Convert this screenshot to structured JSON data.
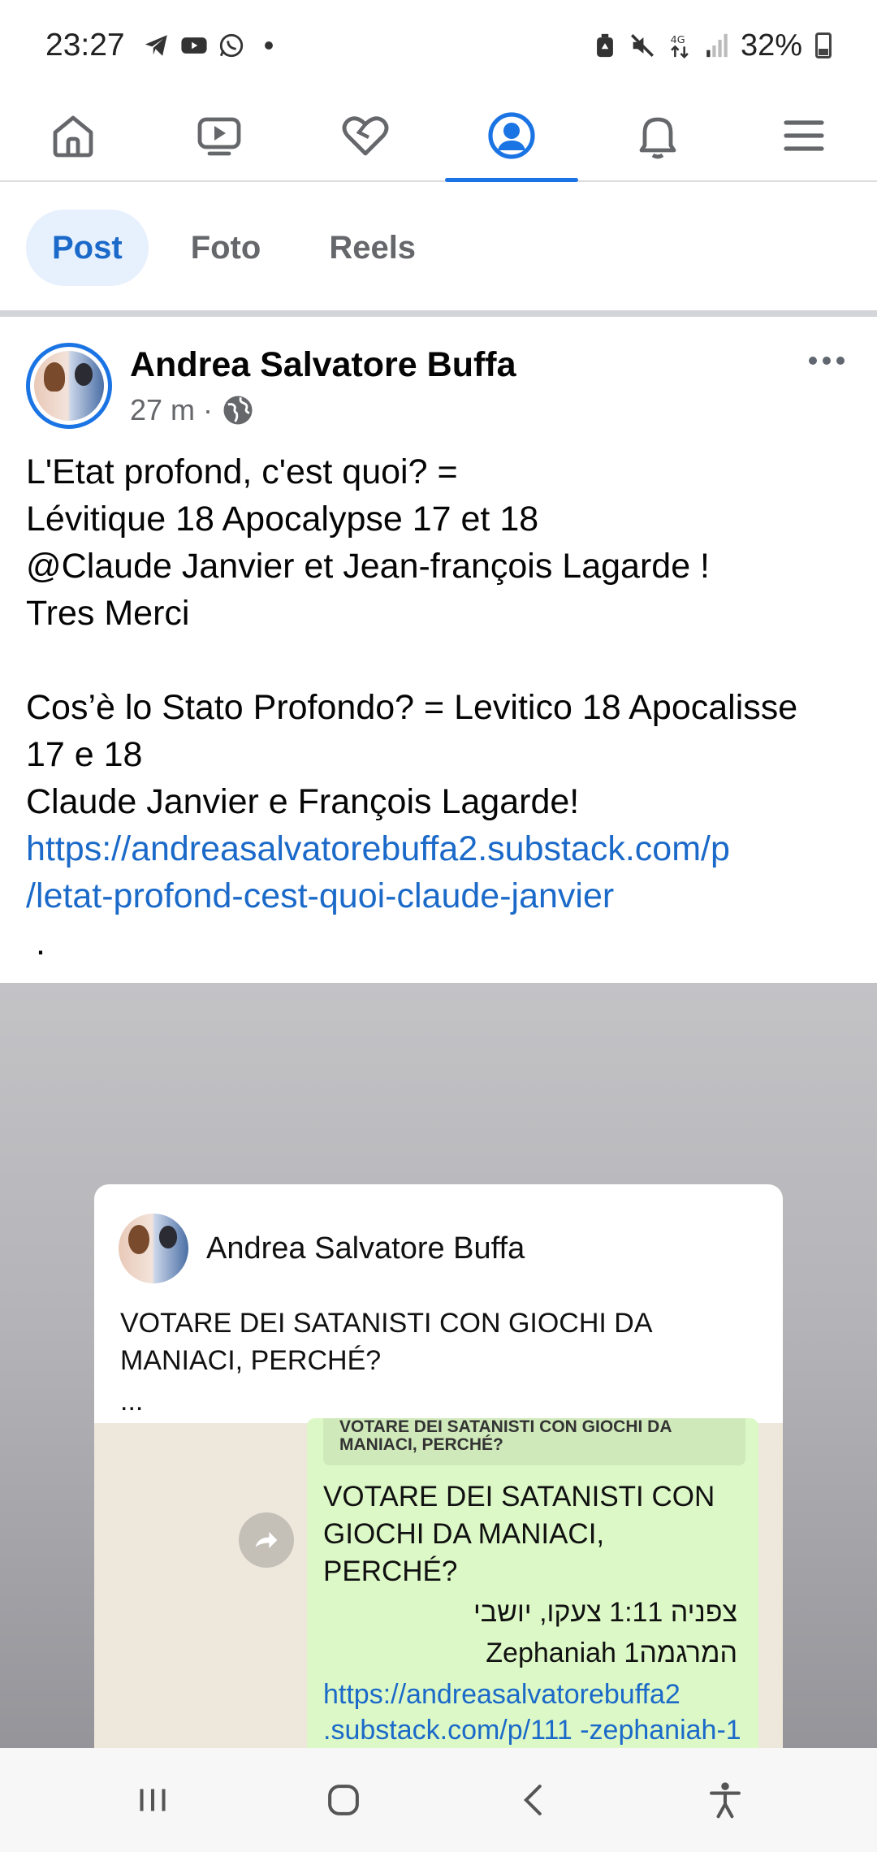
{
  "status_bar": {
    "time": "23:27",
    "battery": "32%",
    "network": "4G",
    "icons": [
      "telegram-icon",
      "youtube-icon",
      "whatsapp-icon",
      "dot-icon",
      "eco-icon",
      "mute-icon",
      "data-icon",
      "signal-icon",
      "battery-icon"
    ]
  },
  "nav": {
    "items": [
      {
        "icon": "home-icon"
      },
      {
        "icon": "video-icon"
      },
      {
        "icon": "dating-heart-icon"
      },
      {
        "icon": "profile-icon",
        "active": true
      },
      {
        "icon": "bell-icon"
      },
      {
        "icon": "menu-icon"
      }
    ]
  },
  "filters": {
    "tabs": [
      {
        "label": "Post",
        "active": true
      },
      {
        "label": "Foto"
      },
      {
        "label": "Reels"
      }
    ]
  },
  "post": {
    "author": "Andrea Salvatore Buffa",
    "time": "27 m",
    "separator": "·",
    "lines": [
      "L'Etat profond, c'est quoi? =",
      "Lévitique 18 Apocalypse 17 et 18",
      "@Claude Janvier et Jean-françois Lagarde !",
      "Tres  Merci",
      "",
      "Cos’è lo Stato Profondo?  = Levitico 18 Apocalisse",
      "17 e 18",
      "Claude Janvier e François Lagarde!"
    ],
    "link_line1": "https://andreasalvatorebuffa2.substack.com/p",
    "link_line2": "/letat-profond-cest-quoi-claude-janvier",
    "trailing": "."
  },
  "shared_card": {
    "author": "Andrea Salvatore Buffa",
    "text": "VOTARE DEI SATANISTI CON GIOCHI DA MANIACI, PERCHÉ?",
    "ellipsis": "...",
    "bubble_quote": "VOTARE DEI SATANISTI CON GIOCHI DA MANIACI, PERCHÉ?",
    "bubble_title": "VOTARE DEI SATANISTI CON GIOCHI DA MANIACI, PERCHÉ?",
    "bubble_hebrew_1": "צפניה 1:11 צעקו, יושבי",
    "bubble_hebrew_2": "Zephaniah 1המרגמה",
    "bubble_link": "https://andreasalvatorebuffa2 .substack.com/p/111 -zephaniah-1"
  },
  "system_nav": {
    "items": [
      "recent-apps-icon",
      "home-button-icon",
      "back-icon",
      "accessibility-icon"
    ]
  },
  "colors": {
    "accent": "#1b74e4",
    "link": "#1b6ac9",
    "chip_active_bg": "#e7f0fd",
    "secondary_text": "#65676b",
    "bubble_green": "#dcf8c6"
  }
}
